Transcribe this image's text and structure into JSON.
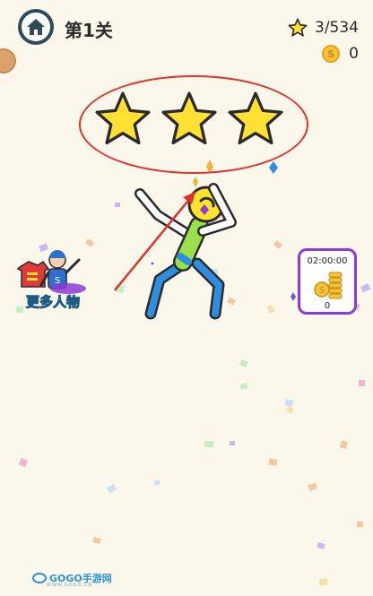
{
  "header": {
    "level_title": "第1关",
    "home_icon": "home-icon",
    "stars": "3/534",
    "coins": "0"
  },
  "rating": {
    "stars_earned": 3,
    "stars_total": 3
  },
  "side": {
    "more_characters_label": "更多人物",
    "reward_timer": "02:00:00",
    "reward_count": "0"
  },
  "watermark": {
    "brand": "GOGO手游网",
    "url": "WWW.GOGO.CN"
  },
  "colors": {
    "background": "#fbf7ea",
    "star_fill": "#ffe033",
    "annotation_red": "#e0312a",
    "figure_green": "#9be04a",
    "figure_blue": "#2e8fe0",
    "figure_head": "#ffe22b",
    "reward_border": "#8d3bd6"
  }
}
